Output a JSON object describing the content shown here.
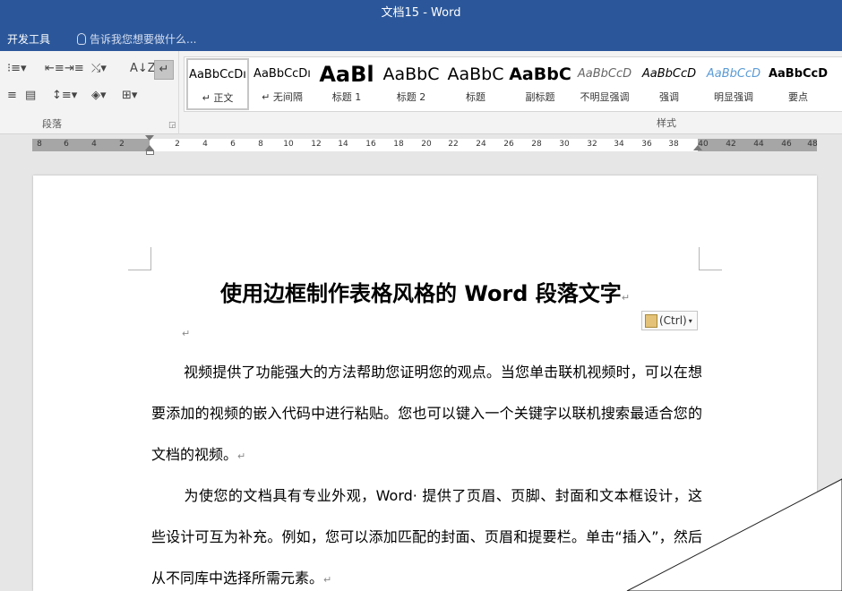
{
  "window": {
    "title": "文档15 - Word"
  },
  "tabs": {
    "developer": "开发工具",
    "tell_me": "告诉我您想要做什么..."
  },
  "ribbon": {
    "paragraph_group_label": "段落",
    "styles_group_label": "样式",
    "styles": [
      {
        "preview": "AaBbCcDı",
        "name": "↵ 正文",
        "active": true
      },
      {
        "preview": "AaBbCcDı",
        "name": "↵ 无间隔"
      },
      {
        "preview": "AaBl",
        "name": "标题 1"
      },
      {
        "preview": "AaBbC",
        "name": "标题 2"
      },
      {
        "preview": "AaBbC",
        "name": "标题"
      },
      {
        "preview": "AaBbC",
        "name": "副标题"
      },
      {
        "preview": "AaBbCcD",
        "name": "不明显强调"
      },
      {
        "preview": "AaBbCcD",
        "name": "强调"
      },
      {
        "preview": "AaBbCcD",
        "name": "明显强调"
      },
      {
        "preview": "AaBbCcD",
        "name": "要点"
      }
    ]
  },
  "ruler": {
    "ticks": [
      "8",
      "6",
      "4",
      "2",
      "2",
      "4",
      "6",
      "8",
      "10",
      "12",
      "14",
      "16",
      "18",
      "20",
      "22",
      "24",
      "26",
      "28",
      "30",
      "32",
      "34",
      "36",
      "38",
      "40",
      "42",
      "44",
      "46",
      "48"
    ]
  },
  "document": {
    "title": "使用边框制作表格风格的 Word 段落文字",
    "paragraph_mark": "↵",
    "paste_options": "(Ctrl)",
    "paragraphs": [
      "视频提供了功能强大的方法帮助您证明您的观点。当您单击联机视频时，可以在想要添加的视频的嵌入代码中进行粘贴。您也可以键入一个关键字以联机搜索最适合您的文档的视频。",
      "为使您的文档具有专业外观，Word· 提供了页眉、页脚、封面和文本框设计，这些设计可互为补充。例如，您可以添加匹配的封面、页眉和提要栏。单击“插入”，然后从不同库中选择所需元素。"
    ]
  }
}
